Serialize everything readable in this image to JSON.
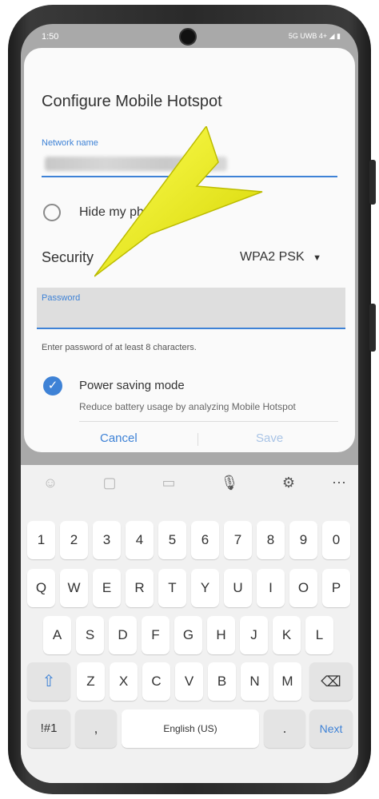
{
  "status_bar": {
    "time": "1:50",
    "indicators": "5G UWB 4+"
  },
  "dialog": {
    "title": "Configure Mobile Hotspot",
    "network_label": "Network name",
    "hide_label": "Hide my phon",
    "security_label": "Security",
    "security_value": "WPA2 PSK",
    "password_label": "Password",
    "password_hint": "Enter password of at least 8 characters.",
    "power_title": "Power saving mode",
    "power_desc": "Reduce battery usage by analyzing Mobile Hotspot",
    "cancel": "Cancel",
    "save": "Save"
  },
  "keyboard": {
    "row_numbers": [
      "1",
      "2",
      "3",
      "4",
      "5",
      "6",
      "7",
      "8",
      "9",
      "0"
    ],
    "row_q": [
      "Q",
      "W",
      "E",
      "R",
      "T",
      "Y",
      "U",
      "I",
      "O",
      "P"
    ],
    "row_a": [
      "A",
      "S",
      "D",
      "F",
      "G",
      "H",
      "J",
      "K",
      "L"
    ],
    "row_z": [
      "Z",
      "X",
      "C",
      "V",
      "B",
      "N",
      "M"
    ],
    "symbols": "!#1",
    "comma": ",",
    "space": "English (US)",
    "period": ".",
    "next": "Next"
  },
  "colors": {
    "accent": "#3e82d6",
    "arrow": "#f2f200"
  }
}
